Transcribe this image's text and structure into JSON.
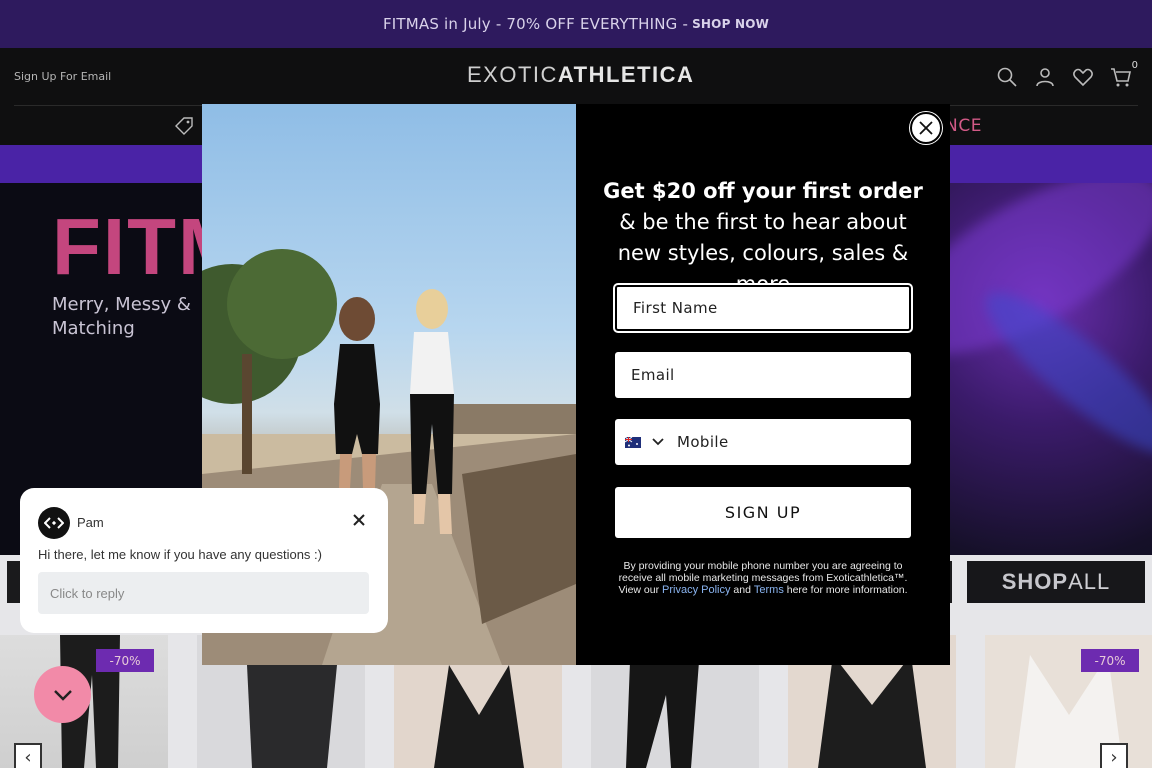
{
  "announcement": {
    "text": "FITMAS in July - 70% OFF EVERYTHING -",
    "cta": "SHOP NOW"
  },
  "header": {
    "signup_link": "Sign Up For Email",
    "logo_light": "EXOTIC",
    "logo_bold": "ATHLETICA",
    "cart_count": "0",
    "icons": [
      "search-icon",
      "account-icon",
      "wishlist-icon",
      "cart-icon"
    ]
  },
  "nav": {
    "clearance_label": "NCE"
  },
  "hero": {
    "title": "FITM",
    "subtitle": "Merry, Messy & Matching"
  },
  "category_strip": {
    "shop_all_bold": "SHOP",
    "shop_all_rest": "ALL"
  },
  "products": {
    "badges": [
      "-70%",
      "-70%"
    ]
  },
  "modal": {
    "headline_bold": "Get $20 off your first order",
    "headline_rest": " & be the first to hear about new styles, colours, sales & more",
    "first_name_placeholder": "First Name",
    "email_placeholder": "Email",
    "mobile_placeholder": "Mobile",
    "signup_label": "SIGN UP",
    "legal_pre": "By providing your mobile phone number you are agreeing to receive all mobile marketing messages from Exoticathletica™. View our",
    "privacy_link": "Privacy Policy",
    "and": "and",
    "terms_link": "Terms",
    "legal_post": "here for more information."
  },
  "chat": {
    "agent_name": "Pam",
    "message": "Hi there, let me know if you have any questions :)",
    "reply_placeholder": "Click to reply"
  },
  "colors": {
    "announce_bg": "#2e1a5e",
    "badge": "#6d2bb0",
    "clearance": "#d25a87",
    "chat_toggle": "#f28aa8"
  }
}
